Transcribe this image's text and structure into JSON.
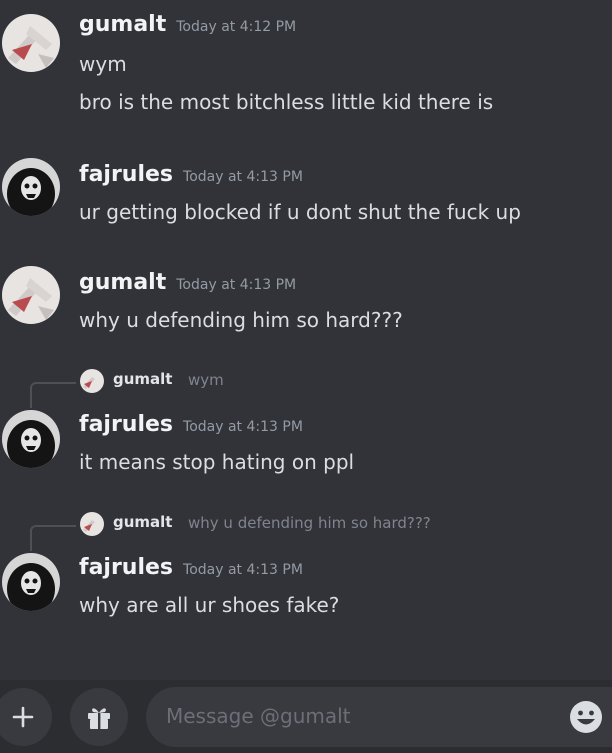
{
  "messages": [
    {
      "author": "gumalt",
      "timestamp": "Today at 4:12 PM",
      "lines": [
        "wym",
        "bro is the most bitchless little kid there is"
      ],
      "avatar": "gumalt-avatar"
    },
    {
      "author": "fajrules",
      "timestamp": "Today at 4:13 PM",
      "lines": [
        "ur getting blocked if u dont shut the fuck up"
      ],
      "avatar": "fajrules-avatar"
    },
    {
      "author": "gumalt",
      "timestamp": "Today at 4:13 PM",
      "lines": [
        "why u defending him so hard???"
      ],
      "avatar": "gumalt-avatar"
    },
    {
      "reply_to": {
        "author": "gumalt",
        "preview": "wym"
      },
      "author": "fajrules",
      "timestamp": "Today at 4:13 PM",
      "lines": [
        "it means stop hating on ppl"
      ],
      "avatar": "fajrules-avatar"
    },
    {
      "reply_to": {
        "author": "gumalt",
        "preview": "why u defending him so hard???"
      },
      "author": "fajrules",
      "timestamp": "Today at 4:13 PM",
      "lines": [
        "why are all ur shoes fake?"
      ],
      "avatar": "fajrules-avatar"
    }
  ],
  "composer": {
    "placeholder": "Message @gumalt",
    "icons": [
      "plus-icon",
      "gift-icon",
      "emoji-icon"
    ]
  },
  "colors": {
    "background": "#313338",
    "composer_bar": "#2b2d31",
    "input": "#383a40",
    "text": "#dbdee1",
    "muted": "#949ba4"
  }
}
